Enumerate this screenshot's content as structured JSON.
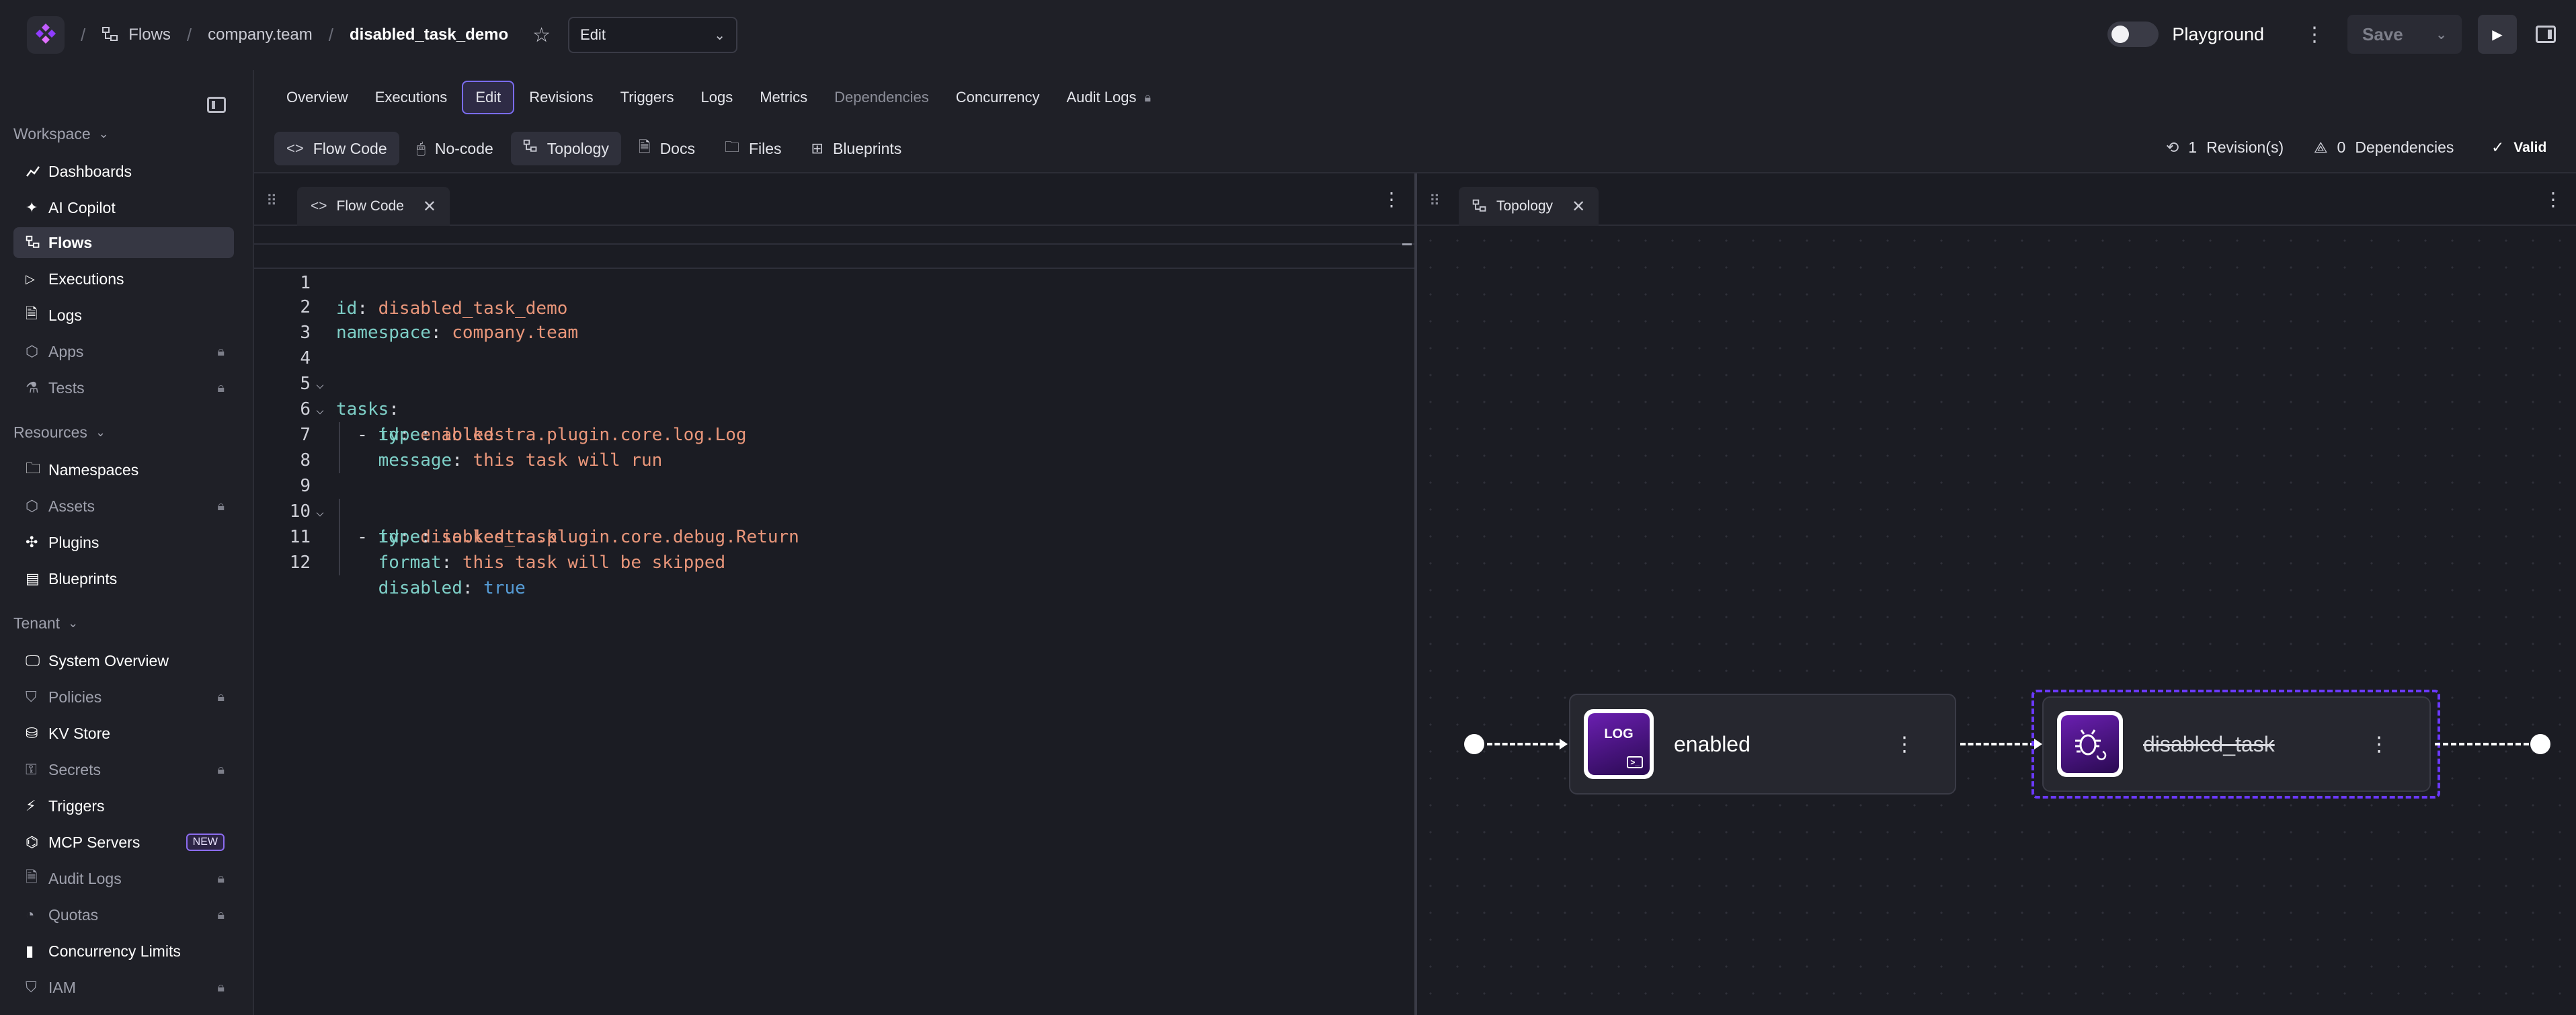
{
  "breadcrumb": {
    "flows": "Flows",
    "namespace": "company.team",
    "flow_id": "disabled_task_demo",
    "separator": "/"
  },
  "header": {
    "mode_select_value": "Edit",
    "playground_label": "Playground",
    "save_label": "Save"
  },
  "sidebar": {
    "workspace_label": "Workspace",
    "resources_label": "Resources",
    "tenant_label": "Tenant",
    "workspace_items": [
      {
        "label": "Dashboards",
        "locked": false
      },
      {
        "label": "AI Copilot",
        "locked": false
      },
      {
        "label": "Flows",
        "locked": false,
        "active": true
      },
      {
        "label": "Executions",
        "locked": false
      },
      {
        "label": "Logs",
        "locked": false
      },
      {
        "label": "Apps",
        "locked": true
      },
      {
        "label": "Tests",
        "locked": true
      }
    ],
    "resources_items": [
      {
        "label": "Namespaces",
        "locked": false
      },
      {
        "label": "Assets",
        "locked": true
      },
      {
        "label": "Plugins",
        "locked": false
      },
      {
        "label": "Blueprints",
        "locked": false
      }
    ],
    "tenant_items": [
      {
        "label": "System Overview",
        "locked": false
      },
      {
        "label": "Policies",
        "locked": true
      },
      {
        "label": "KV Store",
        "locked": false
      },
      {
        "label": "Secrets",
        "locked": true
      },
      {
        "label": "Triggers",
        "locked": false
      },
      {
        "label": "MCP Servers",
        "locked": false,
        "badge": "NEW"
      },
      {
        "label": "Audit Logs",
        "locked": true
      },
      {
        "label": "Quotas",
        "locked": true
      },
      {
        "label": "Concurrency Limits",
        "locked": false
      },
      {
        "label": "IAM",
        "locked": true
      }
    ]
  },
  "tabs": [
    {
      "label": "Overview"
    },
    {
      "label": "Executions"
    },
    {
      "label": "Edit",
      "active": true
    },
    {
      "label": "Revisions"
    },
    {
      "label": "Triggers"
    },
    {
      "label": "Logs"
    },
    {
      "label": "Metrics"
    },
    {
      "label": "Dependencies",
      "disabled": true
    },
    {
      "label": "Concurrency"
    },
    {
      "label": "Audit Logs",
      "locked": true
    }
  ],
  "toolbar": {
    "items": [
      {
        "label": "Flow Code",
        "active": true
      },
      {
        "label": "No-code"
      },
      {
        "label": "Topology",
        "active": true
      },
      {
        "label": "Docs"
      },
      {
        "label": "Files"
      },
      {
        "label": "Blueprints"
      }
    ],
    "revisions_count": "1",
    "revisions_label": "Revision(s)",
    "dependencies_count": "0",
    "dependencies_label": "Dependencies",
    "valid_label": "Valid"
  },
  "editor": {
    "tab_label": "Flow Code",
    "line_numbers": [
      "1",
      "2",
      "3",
      "4",
      "5",
      "6",
      "7",
      "8",
      "9",
      "10",
      "11",
      "12"
    ]
  },
  "topology": {
    "tab_label": "Topology",
    "nodes": [
      {
        "label": "enabled",
        "icon_text": "LOG",
        "disabled": false
      },
      {
        "label": "disabled_task",
        "icon_text": "",
        "disabled": true
      }
    ]
  },
  "colors": {
    "accent": "#7a6cf0",
    "selection": "#6b39ff",
    "yaml_key": "#7ecfc7",
    "yaml_value": "#e9967a",
    "yaml_bool": "#569cd6"
  }
}
